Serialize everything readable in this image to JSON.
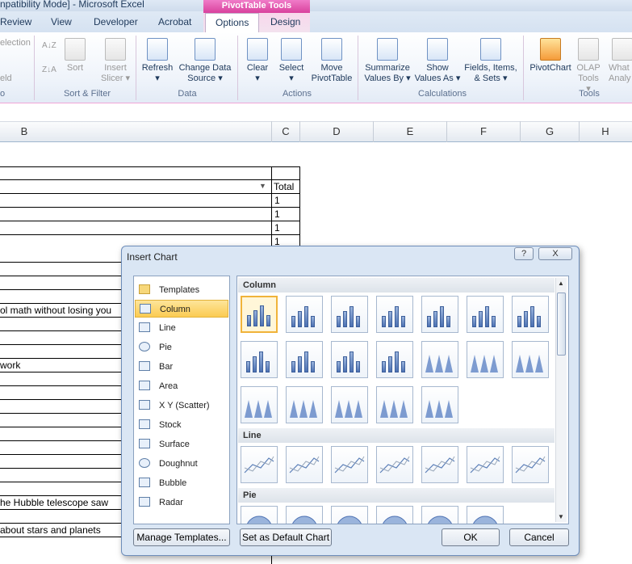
{
  "window": {
    "title": "npatibility Mode] - Microsoft Excel",
    "context_tab_group": "PivotTable Tools"
  },
  "tabs": [
    "Review",
    "View",
    "Developer",
    "Acrobat",
    "Options",
    "Design"
  ],
  "ribbon": {
    "left_partial": [
      "election",
      "eld"
    ],
    "sort_filter": {
      "sort": "Sort",
      "insert_slicer": "Insert",
      "insert_slicer2": "Slicer",
      "group": "Sort & Filter"
    },
    "data": {
      "refresh": "Refresh",
      "change_source": "Change Data",
      "change_source2": "Source",
      "group": "Data"
    },
    "actions": {
      "clear": "Clear",
      "select": "Select",
      "move": "Move",
      "move2": "PivotTable",
      "group": "Actions"
    },
    "calculations": {
      "summarize": "Summarize",
      "summarize2": "Values By",
      "show": "Show",
      "show2": "Values As",
      "fields": "Fields, Items,",
      "fields2": "& Sets",
      "group": "Calculations"
    },
    "tools": {
      "pivotchart": "PivotChart",
      "olap": "OLAP",
      "olap2": "Tools",
      "whatif": "What",
      "whatif2": "Analy",
      "group": "Tools"
    }
  },
  "columns": [
    "B",
    "C",
    "D",
    "E",
    "F",
    "G",
    "H"
  ],
  "sheet": {
    "total_header": "Total",
    "values": [
      "1",
      "1",
      "1",
      "1"
    ],
    "text_rows": [
      "ol math without losing you",
      "work",
      "he Hubble telescope saw",
      "about stars and planets"
    ]
  },
  "dialog": {
    "title": "Insert Chart",
    "help": "?",
    "close": "X",
    "types": [
      "Templates",
      "Column",
      "Line",
      "Pie",
      "Bar",
      "Area",
      "X Y (Scatter)",
      "Stock",
      "Surface",
      "Doughnut",
      "Bubble",
      "Radar"
    ],
    "selected_type": "Column",
    "sections": [
      "Column",
      "Line",
      "Pie"
    ],
    "manage_templates": "Manage Templates...",
    "set_default": "Set as Default Chart",
    "ok": "OK",
    "cancel": "Cancel"
  }
}
